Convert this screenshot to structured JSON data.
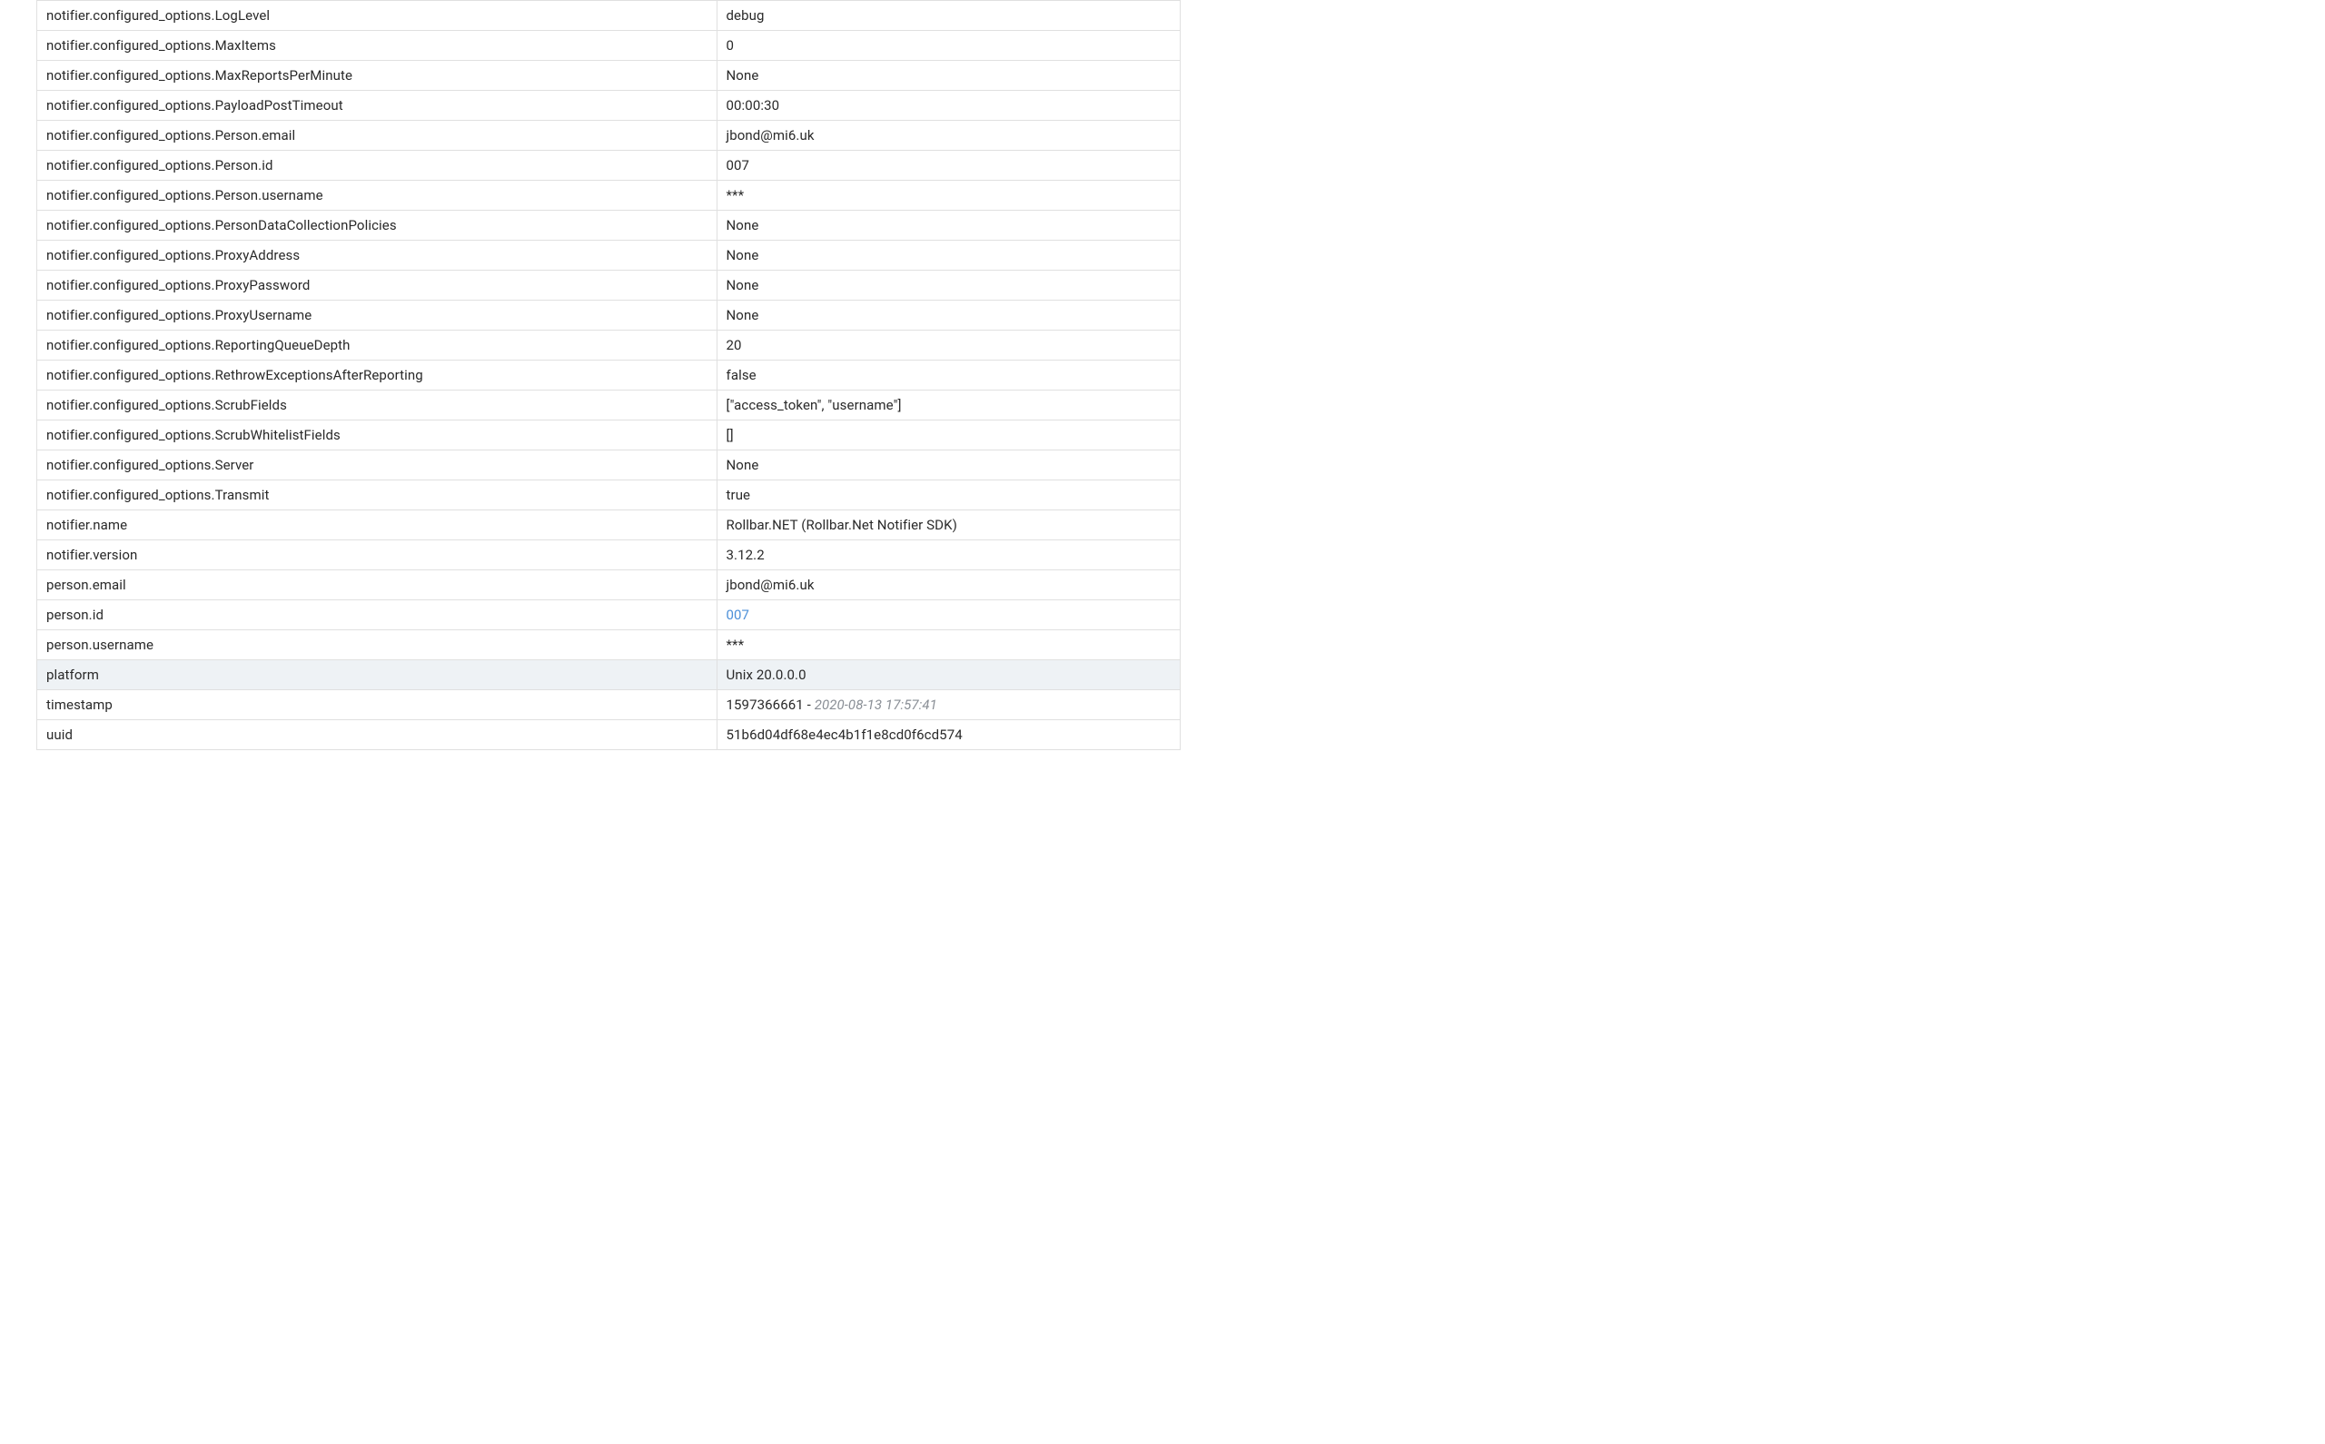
{
  "rows": [
    {
      "key": "notifier.configured_options.LogLevel",
      "value": "debug"
    },
    {
      "key": "notifier.configured_options.MaxItems",
      "value": "0"
    },
    {
      "key": "notifier.configured_options.MaxReportsPerMinute",
      "value": "None"
    },
    {
      "key": "notifier.configured_options.PayloadPostTimeout",
      "value": "00:00:30"
    },
    {
      "key": "notifier.configured_options.Person.email",
      "value": "jbond@mi6.uk"
    },
    {
      "key": "notifier.configured_options.Person.id",
      "value": "007"
    },
    {
      "key": "notifier.configured_options.Person.username",
      "value": "***"
    },
    {
      "key": "notifier.configured_options.PersonDataCollectionPolicies",
      "value": "None"
    },
    {
      "key": "notifier.configured_options.ProxyAddress",
      "value": "None"
    },
    {
      "key": "notifier.configured_options.ProxyPassword",
      "value": "None"
    },
    {
      "key": "notifier.configured_options.ProxyUsername",
      "value": "None"
    },
    {
      "key": "notifier.configured_options.ReportingQueueDepth",
      "value": "20"
    },
    {
      "key": "notifier.configured_options.RethrowExceptionsAfterReporting",
      "value": "false"
    },
    {
      "key": "notifier.configured_options.ScrubFields",
      "value": "[\"access_token\", \"username\"]"
    },
    {
      "key": "notifier.configured_options.ScrubWhitelistFields",
      "value": "[]"
    },
    {
      "key": "notifier.configured_options.Server",
      "value": "None"
    },
    {
      "key": "notifier.configured_options.Transmit",
      "value": "true"
    },
    {
      "key": "notifier.name",
      "value": "Rollbar.NET (Rollbar.Net Notifier SDK)"
    },
    {
      "key": "notifier.version",
      "value": "3.12.2"
    },
    {
      "key": "person.email",
      "value": "jbond@mi6.uk"
    },
    {
      "key": "person.id",
      "value": "007",
      "link": true
    },
    {
      "key": "person.username",
      "value": "***"
    },
    {
      "key": "platform",
      "value": "Unix 20.0.0.0",
      "highlight": true
    },
    {
      "key": "timestamp",
      "value": "1597366661 - ",
      "secondary": "2020-08-13 17:57:41"
    },
    {
      "key": "uuid",
      "value": "51b6d04df68e4ec4b1f1e8cd0f6cd574"
    }
  ]
}
